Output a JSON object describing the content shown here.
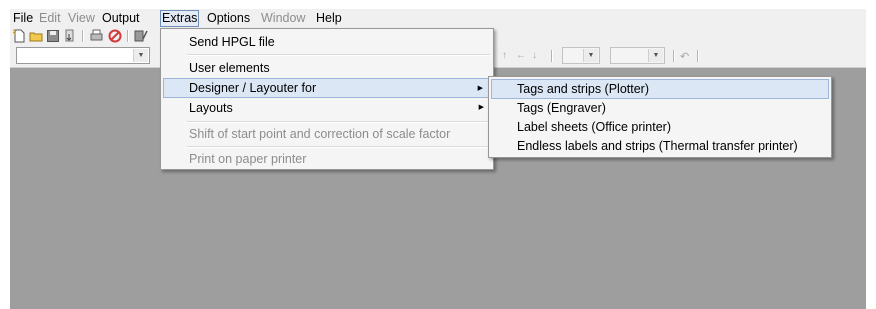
{
  "menubar": {
    "items": [
      {
        "label": "File",
        "enabled": true
      },
      {
        "label": "Edit",
        "enabled": false
      },
      {
        "label": "View",
        "enabled": false
      },
      {
        "label": "Output",
        "enabled": true
      },
      {
        "label": "Extras",
        "enabled": true,
        "open": true
      },
      {
        "label": "Options",
        "enabled": true
      },
      {
        "label": "Window",
        "enabled": false
      },
      {
        "label": "Help",
        "enabled": true
      }
    ]
  },
  "toolbar": {
    "icons": [
      "new-file-icon",
      "open-folder-icon",
      "save-icon",
      "import-icon",
      "print-preview-icon",
      "stop-icon",
      "edit-icon"
    ],
    "nav_icons": [
      "arrow-up-icon",
      "arrow-left-icon",
      "arrow-down-icon",
      "undo-icon"
    ]
  },
  "extras_menu": {
    "items": [
      {
        "label": "Send HPGL file",
        "enabled": true
      },
      {
        "label": "User elements",
        "enabled": true
      },
      {
        "label": "Designer / Layouter for",
        "enabled": true,
        "submenu": true,
        "highlighted": true
      },
      {
        "label": "Layouts",
        "enabled": true,
        "submenu": true
      },
      {
        "label": "Shift of start point and correction of scale factor",
        "enabled": false
      },
      {
        "label": "Print on paper printer",
        "enabled": false
      }
    ]
  },
  "designer_submenu": {
    "items": [
      {
        "label": "Tags and strips (Plotter)",
        "highlighted": true
      },
      {
        "label": "Tags (Engraver)"
      },
      {
        "label": "Label sheets (Office printer)"
      },
      {
        "label": "Endless labels and strips (Thermal transfer printer)"
      }
    ]
  },
  "colors": {
    "workspace": "#9e9e9e",
    "chrome": "#f0f0f0",
    "highlight": "#dce7f5",
    "disabled_text": "#8d8d8d"
  }
}
